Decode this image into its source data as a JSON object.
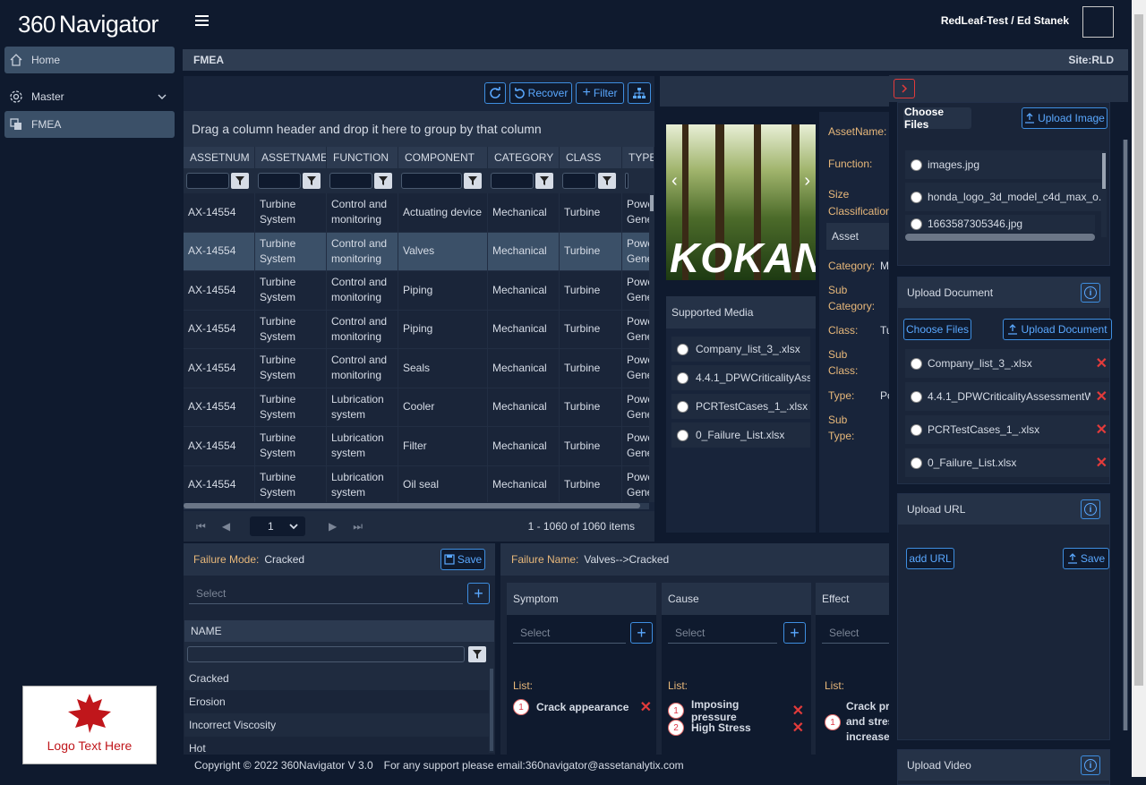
{
  "app": {
    "logo_prefix": "360",
    "logo_name": "Navigator",
    "user": "RedLeaf-Test / Ed Stanek"
  },
  "sidebar": {
    "items": [
      {
        "label": "Home"
      },
      {
        "label": "Master"
      },
      {
        "label": "FMEA"
      }
    ],
    "brand_logo_text": "Logo Text Here"
  },
  "breadcrumb": {
    "title": "FMEA",
    "site": "Site:RLD"
  },
  "toolbar": {
    "recover_label": "Recover",
    "filter_label": "Filter"
  },
  "grid": {
    "group_hint": "Drag a column header and drop it here to group by that column",
    "columns": [
      "ASSETNUM",
      "ASSETNAME",
      "FUNCTION",
      "COMPONENT",
      "CATEGORY",
      "CLASS",
      "TYPE"
    ],
    "rows": [
      [
        "AX-14554",
        "Turbine System",
        "Control and monitoring",
        "Actuating device",
        "Mechanical",
        "Turbine",
        "Power Generation"
      ],
      [
        "AX-14554",
        "Turbine System",
        "Control and monitoring",
        "Valves",
        "Mechanical",
        "Turbine",
        "Power Generation"
      ],
      [
        "AX-14554",
        "Turbine System",
        "Control and monitoring",
        "Piping",
        "Mechanical",
        "Turbine",
        "Power Generation"
      ],
      [
        "AX-14554",
        "Turbine System",
        "Control and monitoring",
        "Piping",
        "Mechanical",
        "Turbine",
        "Power Generation"
      ],
      [
        "AX-14554",
        "Turbine System",
        "Control and monitoring",
        "Seals",
        "Mechanical",
        "Turbine",
        "Power Generation"
      ],
      [
        "AX-14554",
        "Turbine System",
        "Lubrication system",
        "Cooler",
        "Mechanical",
        "Turbine",
        "Power Generation"
      ],
      [
        "AX-14554",
        "Turbine System",
        "Lubrication system",
        "Filter",
        "Mechanical",
        "Turbine",
        "Power Generation"
      ],
      [
        "AX-14554",
        "Turbine System",
        "Lubrication system",
        "Oil seal",
        "Mechanical",
        "Turbine",
        "Power Generation"
      ]
    ],
    "pager": {
      "page": "1",
      "summary": "1 - 1060 of 1060 items"
    }
  },
  "asset": {
    "image_text": "KOKAN",
    "supported_media_title": "Supported Media",
    "media": [
      "Company_list_3_.xlsx",
      "4.4.1_DPWCriticalityAsse...",
      "PCRTestCases_1_.xlsx",
      "0_Failure_List.xlsx"
    ],
    "fields": {
      "asset_name": "AssetName:",
      "function": "Function:",
      "size_class": "Size Classification:",
      "asset_tab": "Asset",
      "category": "Category:",
      "category_val": "M",
      "sub_category": "Sub Category:",
      "class": "Class:",
      "class_val": "Tu",
      "sub_class": "Sub Class:",
      "type": "Type:",
      "type_val": "Po",
      "sub_type": "Sub Type:"
    }
  },
  "failure_mode": {
    "label": "Failure Mode:",
    "value": "Cracked",
    "save_label": "Save",
    "select_placeholder": "Select",
    "name_header": "NAME",
    "items": [
      "Cracked",
      "Erosion",
      "Incorrect Viscosity",
      "Hot"
    ]
  },
  "failure_name": {
    "label": "Failure Name:",
    "value": "Valves-->Cracked"
  },
  "symptom": {
    "title": "Symptom",
    "placeholder": "Select",
    "list_label": "List:",
    "items": [
      "Crack appearance"
    ]
  },
  "cause": {
    "title": "Cause",
    "placeholder": "Select",
    "list_label": "List:",
    "items": [
      "Imposing pressure",
      "High Stress"
    ]
  },
  "effect": {
    "title": "Effect",
    "placeholder": "Select",
    "list_label": "List:",
    "items": [
      "Crack pro... and stress increase"
    ],
    "item_lines": [
      "Crack pro",
      "and stress",
      "increase"
    ]
  },
  "right_panel": {
    "choose_files": "Choose Files",
    "upload_image": "Upload Image",
    "images": [
      "images.jpg",
      "honda_logo_3d_model_c4d_max_o...",
      "1663587305346.jpg"
    ],
    "upload_document_title": "Upload Document",
    "upload_document": "Upload Document",
    "documents": [
      "Company_list_3_.xlsx",
      "4.4.1_DPWCriticalityAssessmentWorki...",
      "PCRTestCases_1_.xlsx",
      "0_Failure_List.xlsx"
    ],
    "upload_url_title": "Upload URL",
    "add_url": "add URL",
    "save_label": "Save",
    "upload_video_title": "Upload Video"
  },
  "footer": {
    "copyright": "Copyright © 2022 360Navigator V 3.0",
    "support": "For any support please email:360navigator@assetanalytix.com"
  },
  "colors": {
    "background": "#0f1a2e",
    "accent": "#3e8ee0",
    "label": "#e8b87a",
    "danger": "#e23b3b"
  }
}
